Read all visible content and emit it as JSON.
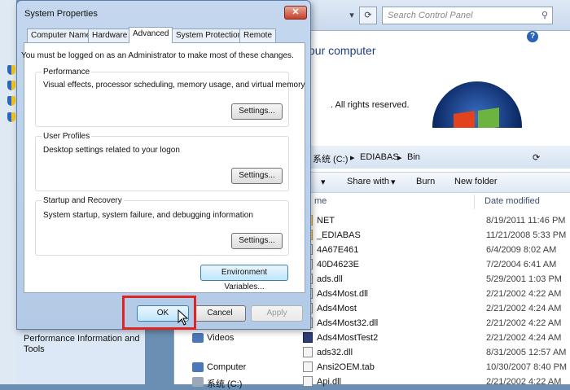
{
  "control_panel": {
    "search_placeholder": "Search Control Panel",
    "title": "our computer",
    "rights": ". All rights reserved."
  },
  "explorer": {
    "breadcrumb": [
      "系统 (C:)",
      "EDIABAS",
      "Bin"
    ],
    "toolbar": {
      "share_with": "Share with",
      "burn": "Burn",
      "new_folder": "New folder"
    },
    "columns": {
      "name": "me",
      "date_modified": "Date modified"
    },
    "files": [
      {
        "name": "NET",
        "date": "8/19/2011 11:46 PM",
        "kind": "folder"
      },
      {
        "name": "_EDIABAS",
        "date": "11/21/2008 5:33 PM",
        "kind": "folder"
      },
      {
        "name": "4A67E461",
        "date": "6/4/2009 8:02 AM",
        "kind": "file"
      },
      {
        "name": "40D4623E",
        "date": "7/2/2004 6:41 AM",
        "kind": "file"
      },
      {
        "name": "ads.dll",
        "date": "5/29/2001 1:03 PM",
        "kind": "file"
      },
      {
        "name": "Ads4Most.dll",
        "date": "2/21/2002 4:22 AM",
        "kind": "file"
      },
      {
        "name": "Ads4Most",
        "date": "2/21/2002 4:24 AM",
        "kind": "file"
      },
      {
        "name": "Ads4Most32.dll",
        "date": "2/21/2002 4:22 AM",
        "kind": "file"
      },
      {
        "name": "Ads4MostTest2",
        "date": "2/21/2002 4:24 AM",
        "kind": "exe"
      },
      {
        "name": "ads32.dll",
        "date": "8/31/2005 12:57 AM",
        "kind": "file"
      },
      {
        "name": "Ansi2OEM.tab",
        "date": "10/30/2007 8:40 PM",
        "kind": "file"
      },
      {
        "name": "Api.dll",
        "date": "2/21/2002 4:22 AM",
        "kind": "file"
      }
    ],
    "nav": {
      "videos": "Videos",
      "computer": "Computer",
      "drive": "系统 (C:)"
    }
  },
  "perf_link": "Performance Information and Tools",
  "dialog": {
    "title": "System Properties",
    "close": "✕",
    "tabs": [
      "Computer Name",
      "Hardware",
      "Advanced",
      "System Protection",
      "Remote"
    ],
    "admin_note": "You must be logged on as an Administrator to make most of these changes.",
    "groups": [
      {
        "title": "Performance",
        "desc": "Visual effects, processor scheduling, memory usage, and virtual memory",
        "button": "Settings..."
      },
      {
        "title": "User Profiles",
        "desc": "Desktop settings related to your logon",
        "button": "Settings..."
      },
      {
        "title": "Startup and Recovery",
        "desc": "System startup, system failure, and debugging information",
        "button": "Settings..."
      }
    ],
    "env_button": "Environment Variables...",
    "ok": "OK",
    "cancel": "Cancel",
    "apply": "Apply"
  }
}
